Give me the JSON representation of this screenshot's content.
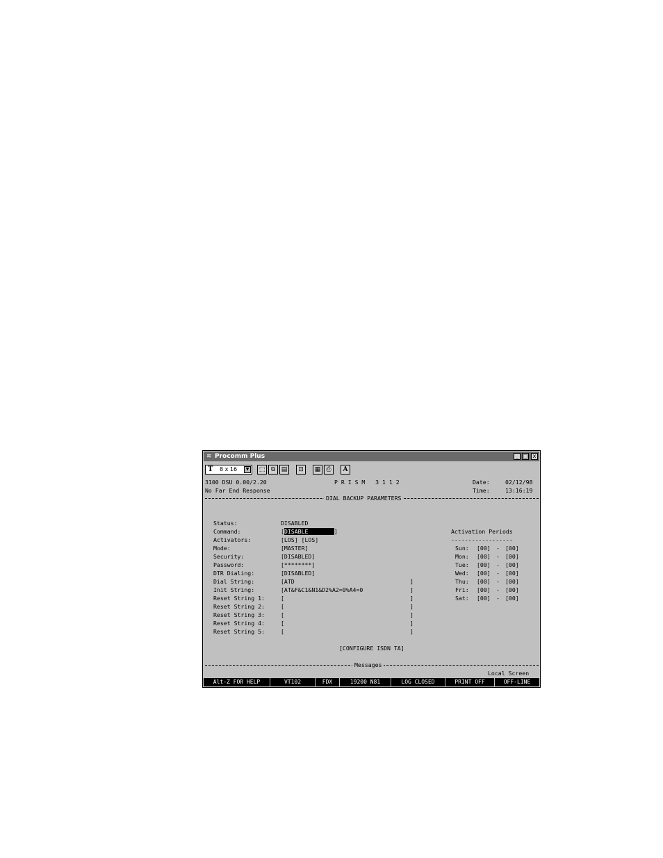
{
  "window": {
    "title": "Procomm Plus",
    "app_icon": "procomm-icon",
    "controls": {
      "minimize": "_",
      "maximize": "□",
      "close": "x"
    }
  },
  "toolbar": {
    "font_size": "8 x 16",
    "buttons": [
      "select-icon",
      "copy-icon",
      "paste-icon",
      "capture-icon",
      "print-setup-icon",
      "print-icon",
      "font-icon"
    ],
    "font_label": "A"
  },
  "terminal": {
    "header": {
      "version": "3100 DSU 0.00/2.20",
      "product": "P R I S M   3 1 1 2",
      "date_label": "Date:",
      "date_value": "02/12/98",
      "status_msg": "No Far End Response",
      "time_label": "Time:",
      "time_value": "13:16:19"
    },
    "section_title": "DIAL BACKUP PARAMETERS",
    "params": [
      {
        "label": "Status:",
        "value": "DISABLED"
      },
      {
        "label": "Command:",
        "value": "[",
        "selected": "DISABLE",
        "close": "]"
      },
      {
        "label": "Activators:",
        "value": "[LOS] [LOS]"
      },
      {
        "label": "Mode:",
        "value": "[MASTER]"
      },
      {
        "label": "Security:",
        "value": "[DISABLED]"
      },
      {
        "label": "Password:",
        "value": "[********]"
      },
      {
        "label": "DTR Dialing:",
        "value": "[DISABLED]"
      },
      {
        "label": "Dial String:",
        "value": "[ATD",
        "close": "]"
      },
      {
        "label": "Init String:",
        "value": "[AT&F&C1&N1&D2%A2=0%A4=0",
        "close": "]"
      },
      {
        "label": "Reset String 1:",
        "value": "[",
        "close": "]"
      },
      {
        "label": "Reset String 2:",
        "value": "[",
        "close": "]"
      },
      {
        "label": "Reset String 3:",
        "value": "[",
        "close": "]"
      },
      {
        "label": "Reset String 4:",
        "value": "[",
        "close": "]"
      },
      {
        "label": "Reset String 5:",
        "value": "[",
        "close": "]"
      }
    ],
    "activation": {
      "title": "Activation Periods",
      "underline": "------------------",
      "days": [
        {
          "day": "Sun:",
          "start": "[00]",
          "end": "[00]"
        },
        {
          "day": "Mon:",
          "start": "[00]",
          "end": "[00]"
        },
        {
          "day": "Tue:",
          "start": "[00]",
          "end": "[00]"
        },
        {
          "day": "Wed:",
          "start": "[00]",
          "end": "[00]"
        },
        {
          "day": "Thu:",
          "start": "[00]",
          "end": "[00]"
        },
        {
          "day": "Fri:",
          "start": "[00]",
          "end": "[00]"
        },
        {
          "day": "Sat:",
          "start": "[00]",
          "end": "[00]"
        }
      ],
      "dash": "-"
    },
    "configure_isdn": "[CONFIGURE ISDN TA]",
    "messages_title": "Messages",
    "local_screen": "Local Screen"
  },
  "statusbar": [
    "Alt-Z FOR HELP",
    "VT102",
    "FDX",
    "19200 N81",
    "LOG CLOSED",
    "PRINT OFF",
    "OFF-LINE"
  ]
}
